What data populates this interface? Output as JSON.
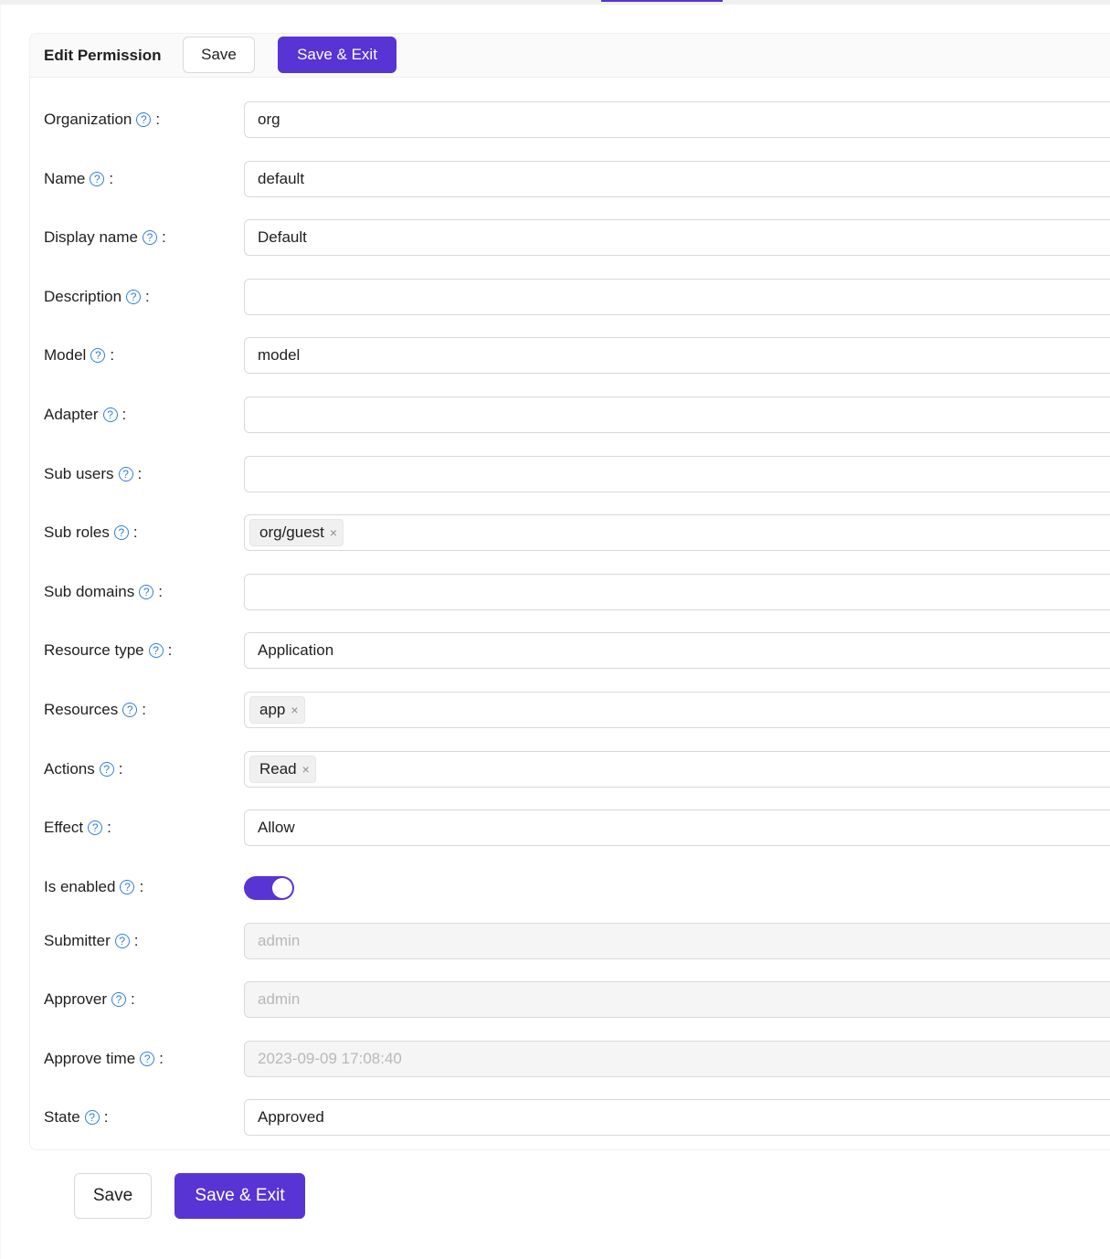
{
  "header": {
    "title": "Edit Permission",
    "save_label": "Save",
    "save_exit_label": "Save & Exit"
  },
  "help_glyph": "?",
  "colon": ":",
  "fields": {
    "organization": {
      "label": "Organization",
      "value": "org"
    },
    "name": {
      "label": "Name",
      "value": "default"
    },
    "display_name": {
      "label": "Display name",
      "value": "Default"
    },
    "description": {
      "label": "Description",
      "value": ""
    },
    "model": {
      "label": "Model",
      "value": "model"
    },
    "adapter": {
      "label": "Adapter",
      "value": ""
    },
    "sub_users": {
      "label": "Sub users",
      "value": ""
    },
    "sub_roles": {
      "label": "Sub roles",
      "tags": [
        "org/guest"
      ]
    },
    "sub_domains": {
      "label": "Sub domains",
      "value": ""
    },
    "resource_type": {
      "label": "Resource type",
      "value": "Application"
    },
    "resources": {
      "label": "Resources",
      "tags": [
        "app"
      ]
    },
    "actions": {
      "label": "Actions",
      "tags": [
        "Read"
      ]
    },
    "effect": {
      "label": "Effect",
      "value": "Allow"
    },
    "is_enabled": {
      "label": "Is enabled",
      "checked": true
    },
    "submitter": {
      "label": "Submitter",
      "value": "admin"
    },
    "approver": {
      "label": "Approver",
      "value": "admin"
    },
    "approve_time": {
      "label": "Approve time",
      "value": "2023-09-09 17:08:40"
    },
    "state": {
      "label": "State",
      "value": "Approved"
    }
  },
  "tag_close_glyph": "×",
  "footer": {
    "save_label": "Save",
    "save_exit_label": "Save & Exit"
  },
  "colors": {
    "primary": "#5734d3",
    "help_icon": "#2f7fdc"
  }
}
